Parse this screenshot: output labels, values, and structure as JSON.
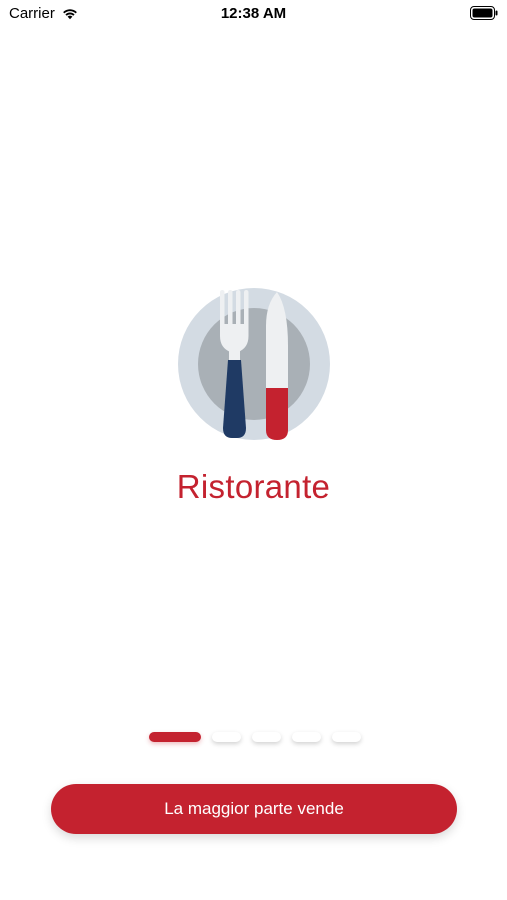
{
  "status_bar": {
    "carrier": "Carrier",
    "time": "12:38 AM"
  },
  "hero": {
    "icon": "plate-fork-knife-icon",
    "title": "Ristorante"
  },
  "pager": {
    "total": 5,
    "active_index": 0
  },
  "cta": {
    "label": "La maggior parte vende"
  },
  "colors": {
    "accent": "#c4222f",
    "navy": "#1f3a64",
    "plate_outer": "#d3dbe3",
    "plate_inner": "#a9b0b6"
  }
}
